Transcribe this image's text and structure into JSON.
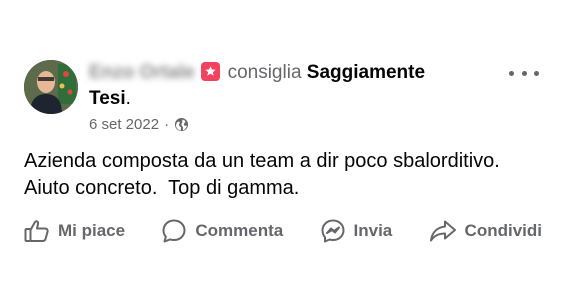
{
  "post": {
    "author_name": "Enzo Ortale",
    "verb": "consiglia",
    "page_name_part1": "Saggiamente",
    "page_name_part2": "Tesi",
    "page_name_suffix": ".",
    "date": "6 set 2022",
    "separator": "·",
    "privacy_icon": "globe-icon",
    "recommend_icon": "recommendation-star-icon",
    "recommend_color": "#f3425f",
    "text": "Azienda composta da un team a dir poco sbalorditivo.\nAiuto concreto.  Top di gamma."
  },
  "actions": {
    "like_label": "Mi piace",
    "comment_label": "Commenta",
    "send_label": "Invia",
    "share_label": "Condividi"
  }
}
